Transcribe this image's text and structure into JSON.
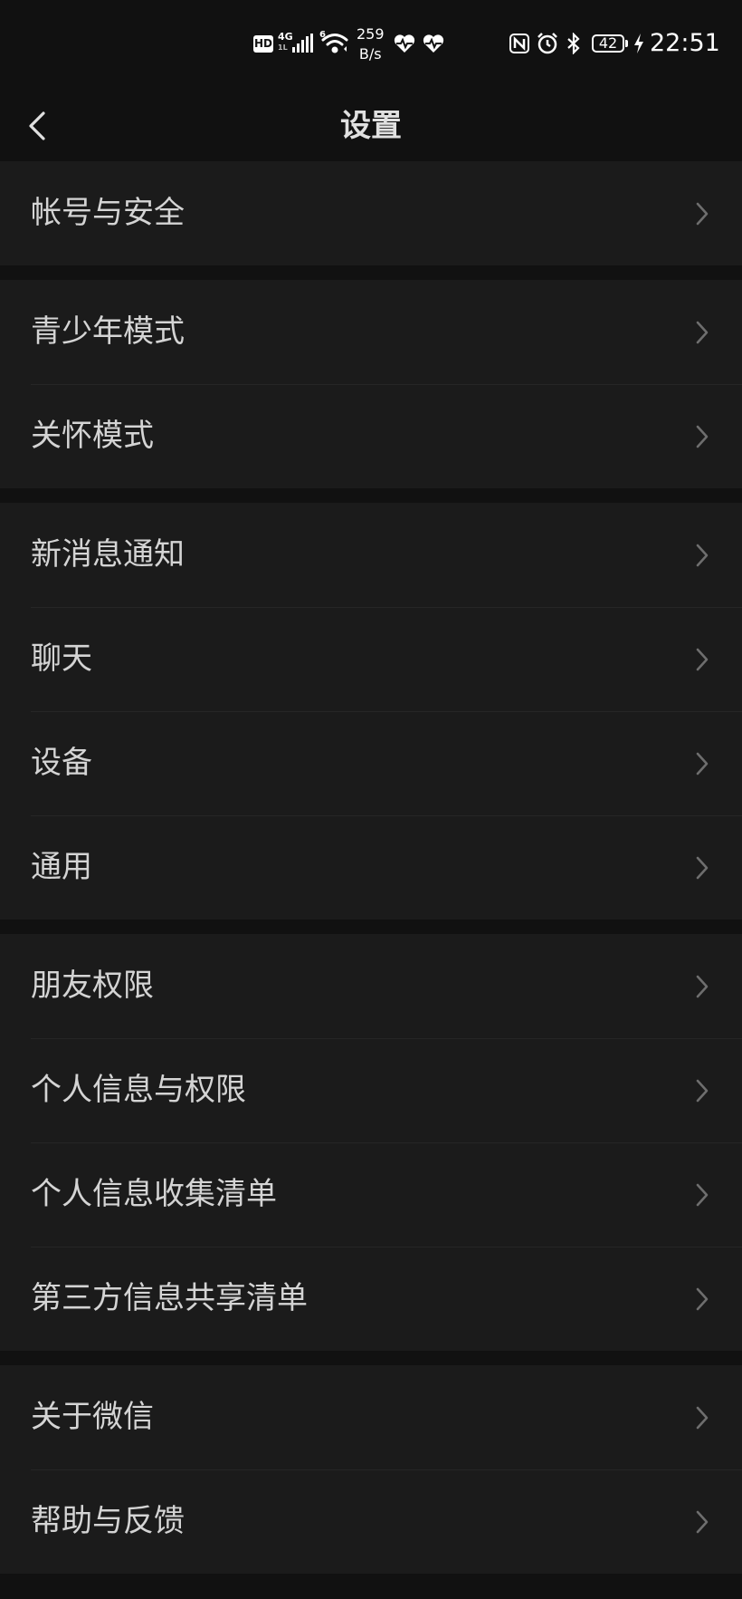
{
  "status_bar": {
    "hd": "HD",
    "net_type_top": "4G",
    "net_type_bottom": "1L",
    "wifi_sup": "6",
    "speed_value": "259",
    "speed_unit": "B/s",
    "battery_level": "42",
    "time": "22:51",
    "icons": [
      "hd-icon",
      "signal-icon",
      "wifi-icon",
      "heart-rate-icon",
      "heart-rate-icon",
      "nfc-icon",
      "alarm-icon",
      "bluetooth-icon",
      "battery-icon",
      "charging-icon"
    ]
  },
  "nav": {
    "title": "设置",
    "back_icon": "chevron-left-icon"
  },
  "groups": [
    {
      "items": [
        {
          "id": "account-security",
          "label": "帐号与安全"
        }
      ]
    },
    {
      "items": [
        {
          "id": "teen-mode",
          "label": "青少年模式"
        },
        {
          "id": "care-mode",
          "label": "关怀模式"
        }
      ]
    },
    {
      "items": [
        {
          "id": "notifications",
          "label": "新消息通知"
        },
        {
          "id": "chat",
          "label": "聊天"
        },
        {
          "id": "devices",
          "label": "设备"
        },
        {
          "id": "general",
          "label": "通用"
        }
      ]
    },
    {
      "items": [
        {
          "id": "friend-permissions",
          "label": "朋友权限"
        },
        {
          "id": "personal-info-permissions",
          "label": "个人信息与权限"
        },
        {
          "id": "personal-info-collection-list",
          "label": "个人信息收集清单"
        },
        {
          "id": "third-party-sharing-list",
          "label": "第三方信息共享清单"
        }
      ]
    },
    {
      "items": [
        {
          "id": "about-wechat",
          "label": "关于微信"
        },
        {
          "id": "help-feedback",
          "label": "帮助与反馈"
        }
      ]
    }
  ],
  "colors": {
    "background": "#111111",
    "group_background": "#1b1b1b",
    "divider": "#262626",
    "text": "#d4d4d4",
    "chevron": "#6e6e6e"
  }
}
